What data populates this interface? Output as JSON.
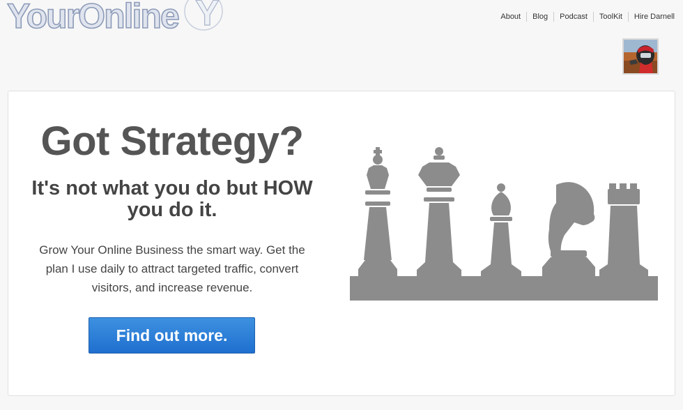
{
  "logo": {
    "text": "YourOnline",
    "mark": "Y"
  },
  "nav": {
    "items": [
      {
        "label": "About"
      },
      {
        "label": "Blog"
      },
      {
        "label": "Podcast"
      },
      {
        "label": "ToolKit"
      },
      {
        "label": "Hire Darnell"
      }
    ]
  },
  "hero": {
    "headline": "Got Strategy?",
    "subhead": "It's not what you do but HOW you do it.",
    "body": "Grow Your Online Business the smart way. Get the plan I use daily to attract targeted traffic, convert visitors, and increase revenue.",
    "cta_label": "Find out more."
  },
  "colors": {
    "page_background": "#f7f7f7",
    "headline": "#555555",
    "cta_blue": "#2a7bd6",
    "chess_gray": "#8c8c8c"
  },
  "icons": {
    "avatar": "profile-photo",
    "chess": "chess-pieces-illustration"
  }
}
